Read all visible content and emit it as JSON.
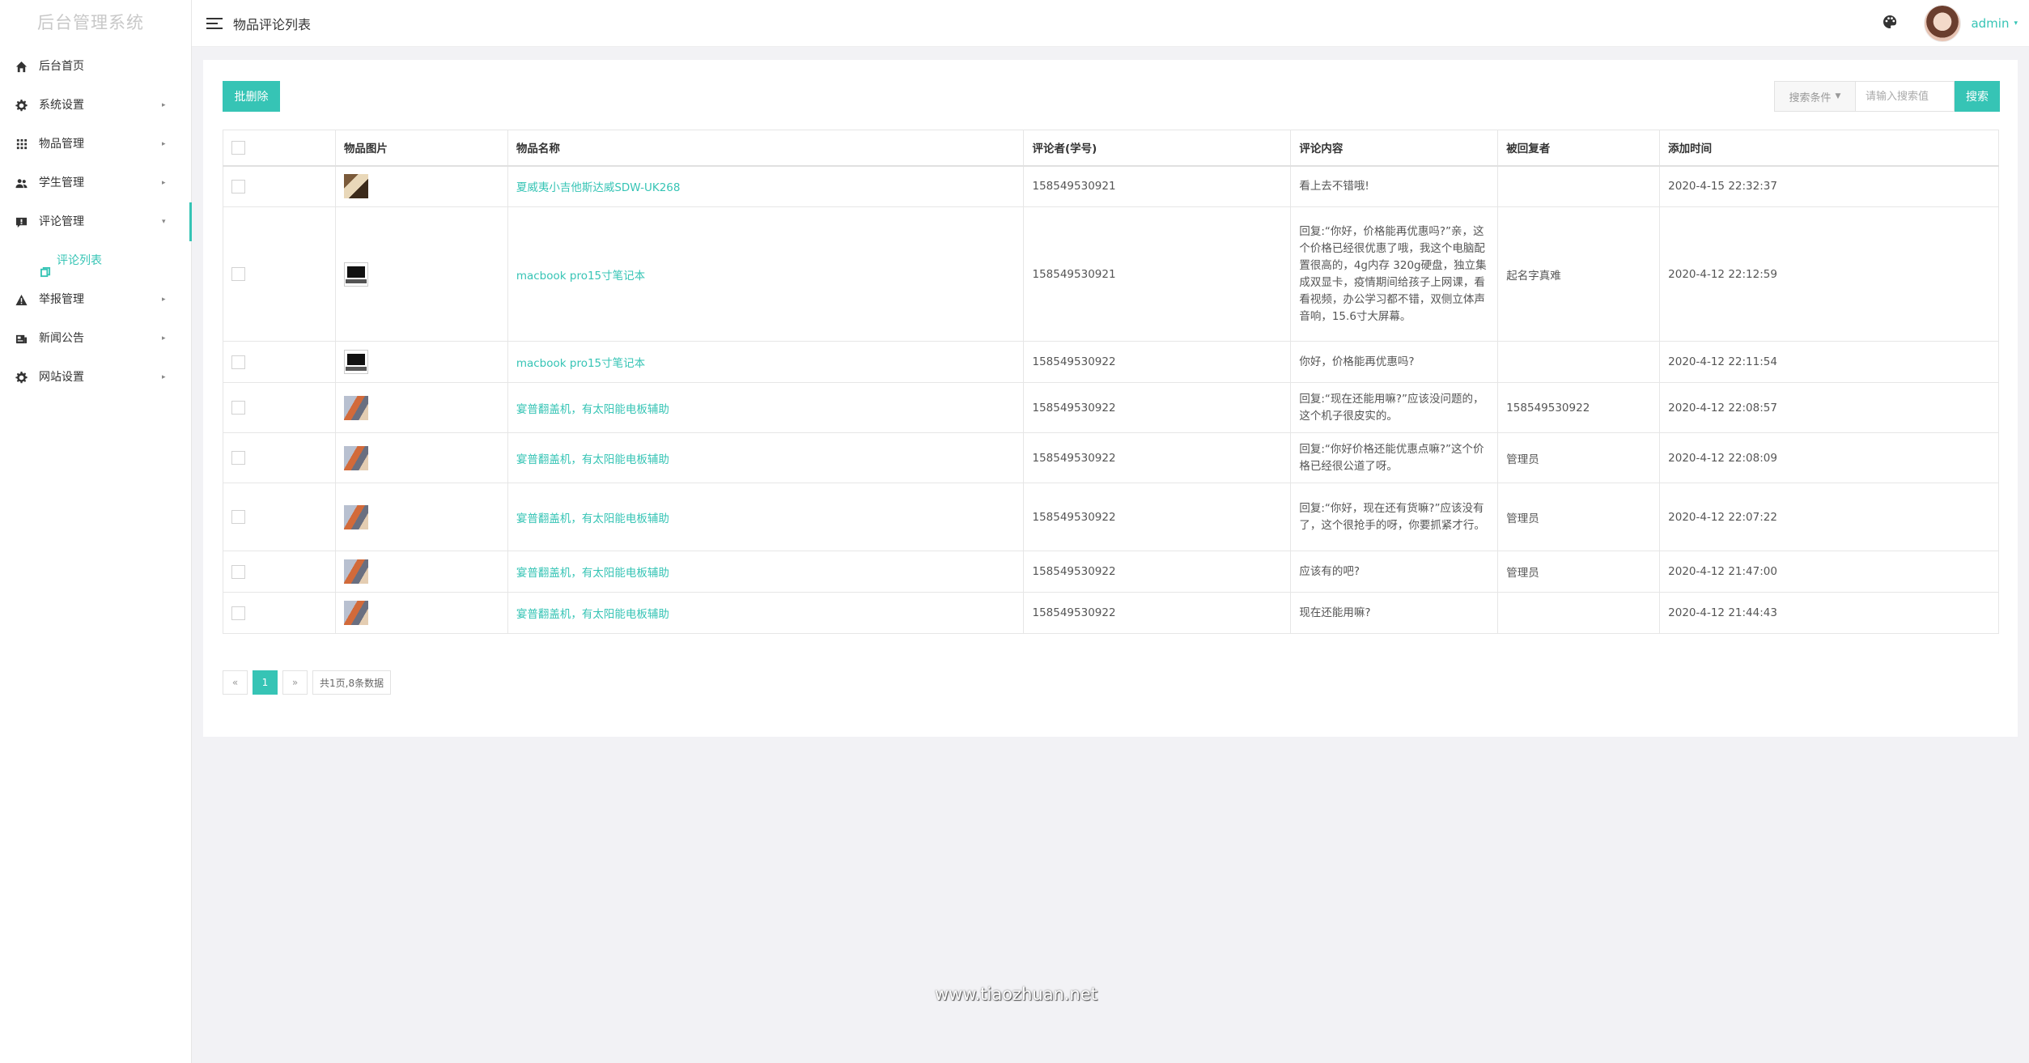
{
  "sidebar": {
    "logo": "后台管理系统",
    "items": [
      {
        "label": "后台首页",
        "icon": "home-icon"
      },
      {
        "label": "系统设置",
        "icon": "gear-icon",
        "caret": "▸"
      },
      {
        "label": "物品管理",
        "icon": "grid-icon",
        "caret": "▸"
      },
      {
        "label": "学生管理",
        "icon": "users-icon",
        "caret": "▸"
      },
      {
        "label": "评论管理",
        "icon": "comment-icon",
        "caret": "▾"
      },
      {
        "label": "举报管理",
        "icon": "warning-icon",
        "caret": "▸"
      },
      {
        "label": "新闻公告",
        "icon": "news-icon",
        "caret": "▸"
      },
      {
        "label": "网站设置",
        "icon": "gear-icon",
        "caret": "▸"
      }
    ],
    "submenu": {
      "label": "评论列表",
      "icon": "copy-icon"
    }
  },
  "header": {
    "title": "物品评论列表",
    "username": "admin",
    "user_caret": "▾"
  },
  "toolbar": {
    "batch_delete": "批删除",
    "search_select": "搜索条件",
    "search_placeholder": "请输入搜索值",
    "search_button": "搜索"
  },
  "table": {
    "headers": [
      "物品图片",
      "物品名称",
      "评论者(学号)",
      "评论内容",
      "被回复者",
      "添加时间"
    ],
    "rows": [
      {
        "thumb": "guitar",
        "name": "夏威夷小吉他斯达威SDW-UK268",
        "commenter": "158549530921",
        "content": "看上去不错哦!",
        "reply_to": "",
        "time": "2020-4-15 22:32:37"
      },
      {
        "thumb": "laptop",
        "name": "macbook pro15寸笔记本",
        "commenter": "158549530921",
        "content": "回复:“你好，价格能再优惠吗?”亲，这个价格已经很优惠了哦，我这个电脑配置很高的，4g内存 320g硬盘，独立集成双显卡，疫情期间给孩子上网课，看看视频，办公学习都不错，双侧立体声音响，15.6寸大屏幕。",
        "reply_to": "起名字真难",
        "time": "2020-4-12 22:12:59"
      },
      {
        "thumb": "laptop",
        "name": "macbook pro15寸笔记本",
        "commenter": "158549530922",
        "content": "你好，价格能再优惠吗?",
        "reply_to": "",
        "time": "2020-4-12 22:11:54"
      },
      {
        "thumb": "cycle",
        "name": "宴普翻盖机，有太阳能电板辅助",
        "commenter": "158549530922",
        "content": "回复:“现在还能用嘛?”应该没问题的，这个机子很皮实的。",
        "reply_to": "158549530922",
        "time": "2020-4-12 22:08:57"
      },
      {
        "thumb": "cycle",
        "name": "宴普翻盖机，有太阳能电板辅助",
        "commenter": "158549530922",
        "content": "回复:“你好价格还能优惠点嘛?”这个价格已经很公道了呀。",
        "reply_to": "管理员",
        "time": "2020-4-12 22:08:09"
      },
      {
        "thumb": "cycle",
        "name": "宴普翻盖机，有太阳能电板辅助",
        "commenter": "158549530922",
        "content": "回复:“你好，现在还有货嘛?”应该没有了，这个很抢手的呀，你要抓紧才行。",
        "reply_to": "管理员",
        "time": "2020-4-12 22:07:22"
      },
      {
        "thumb": "cycle",
        "name": "宴普翻盖机，有太阳能电板辅助",
        "commenter": "158549530922",
        "content": "应该有的吧?",
        "reply_to": "管理员",
        "time": "2020-4-12 21:47:00"
      },
      {
        "thumb": "cycle",
        "name": "宴普翻盖机，有太阳能电板辅助",
        "commenter": "158549530922",
        "content": "现在还能用嘛?",
        "reply_to": "",
        "time": "2020-4-12 21:44:43"
      }
    ]
  },
  "pagination": {
    "prev": "«",
    "current": "1",
    "next": "»",
    "info": "共1页,8条数据"
  },
  "watermark": "www.tiaozhuan.net",
  "colors": {
    "accent": "#36c4b5",
    "time": "#18a35a"
  }
}
